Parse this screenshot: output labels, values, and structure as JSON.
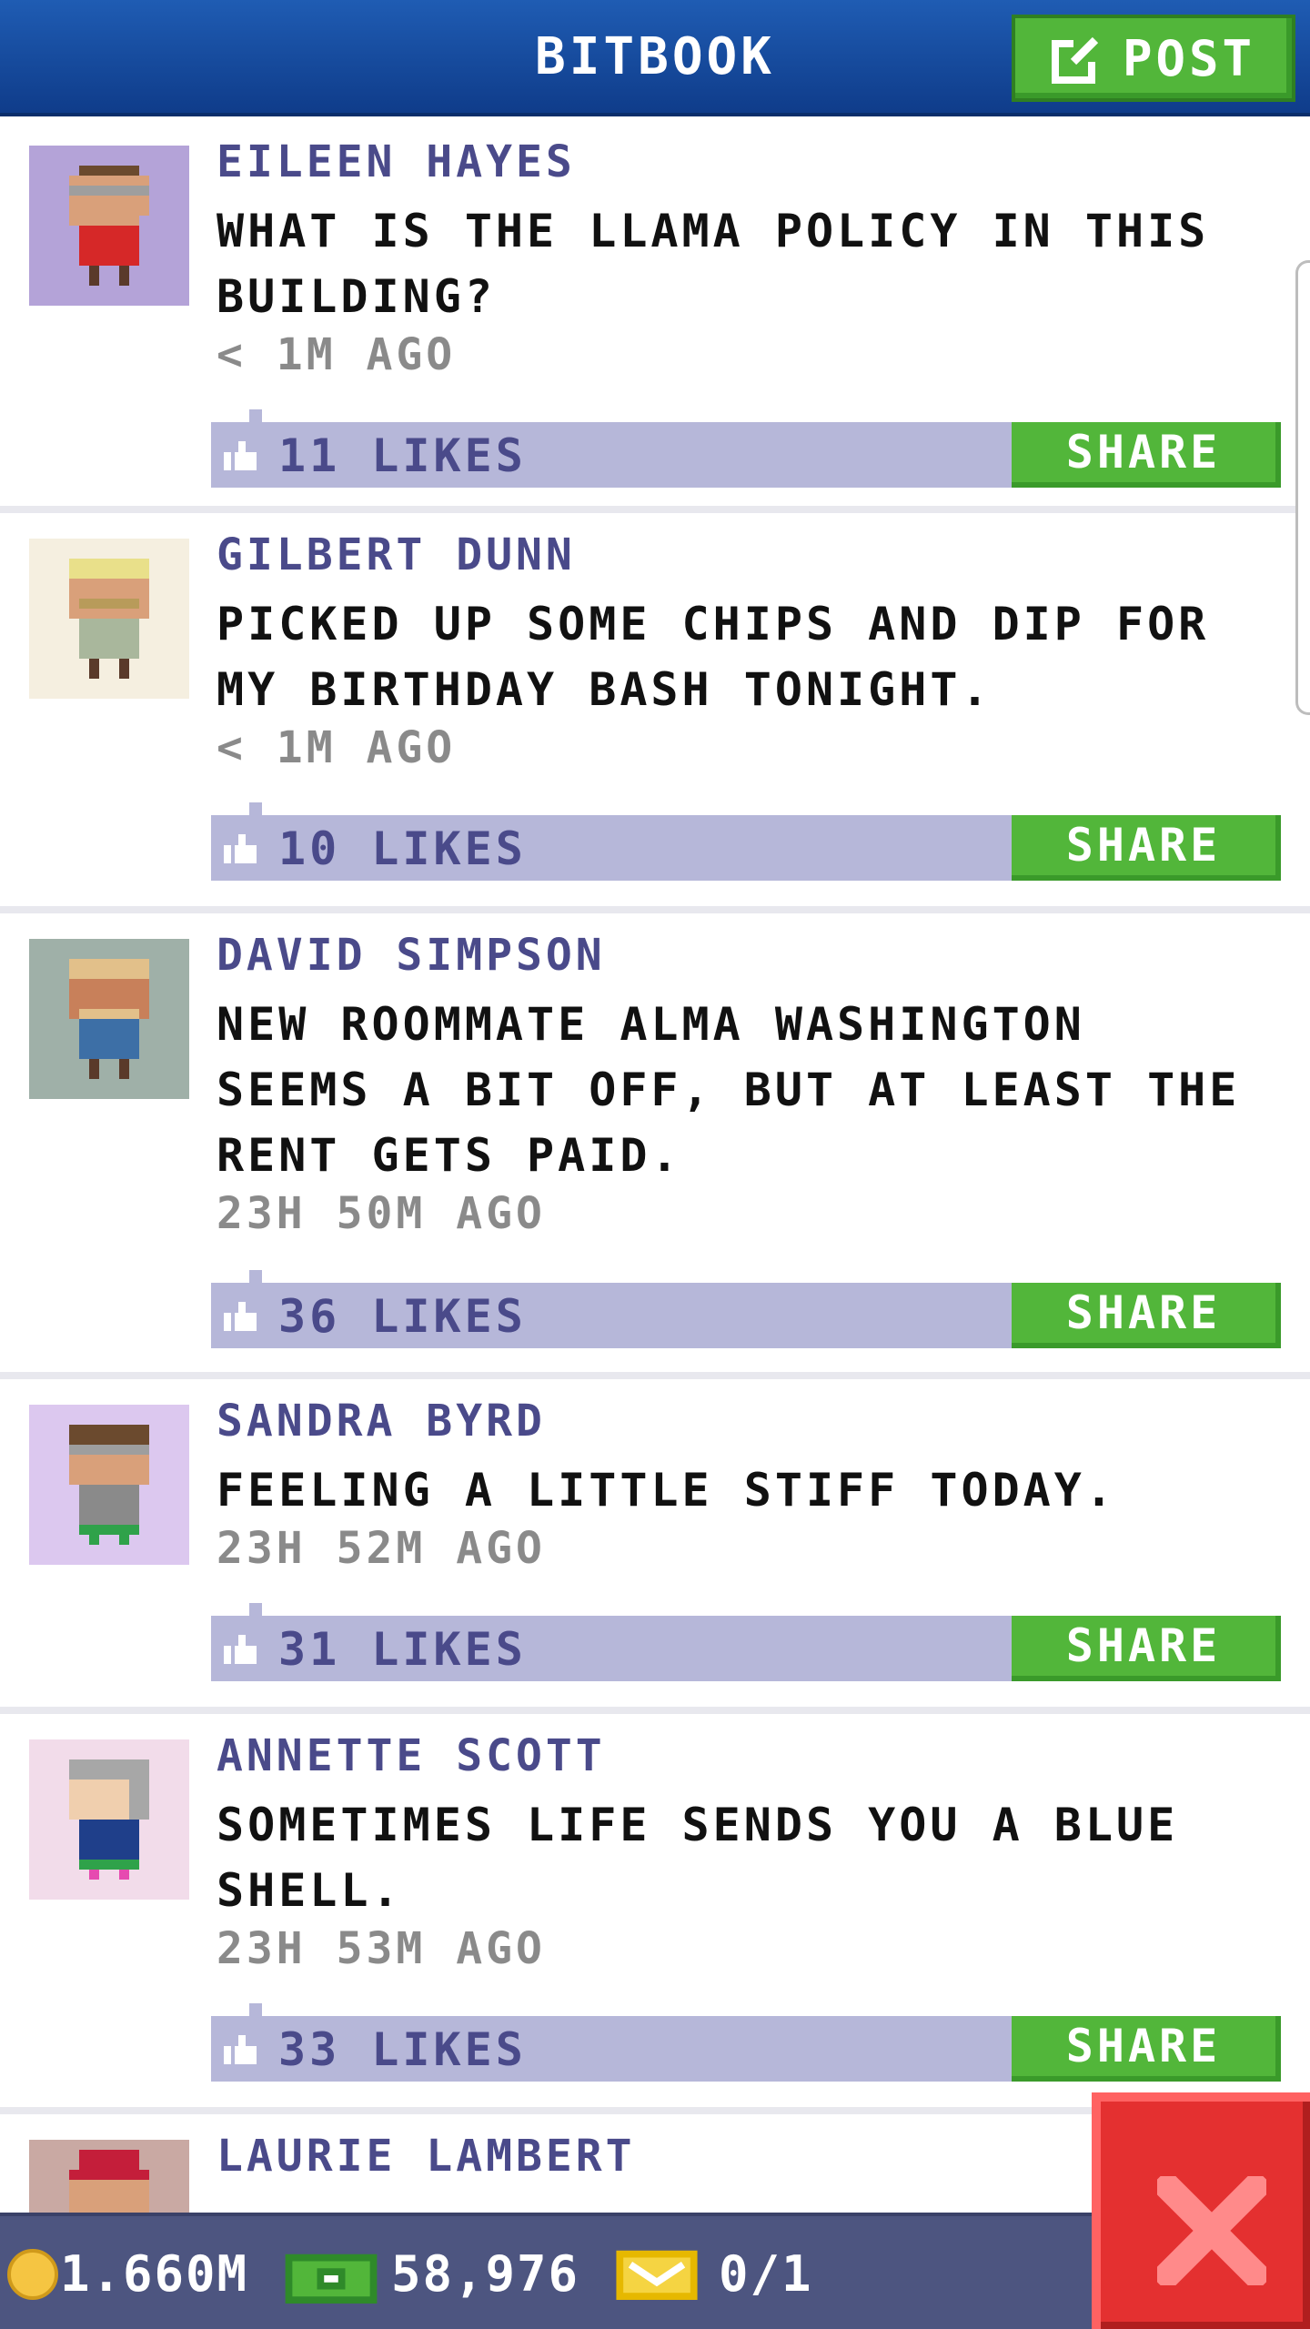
{
  "header": {
    "title": "BITBOOK",
    "post_label": "POST"
  },
  "posts": [
    {
      "author": "EILEEN HAYES",
      "text": "WHAT IS THE LLAMA POLICY IN THIS BUILDING?",
      "time": "< 1M AGO",
      "likes": "11 LIKES",
      "share_label": "SHARE",
      "avatar_bg": "#b4a3d8"
    },
    {
      "author": "GILBERT DUNN",
      "text": "PICKED UP SOME CHIPS AND DIP FOR MY BIRTHDAY BASH TONIGHT.",
      "time": "< 1M AGO",
      "likes": "10 LIKES",
      "share_label": "SHARE",
      "avatar_bg": "#f5efe0"
    },
    {
      "author": "DAVID SIMPSON",
      "text": "NEW ROOMMATE ALMA WASHINGTON SEEMS A BIT OFF, BUT AT LEAST THE RENT GETS PAID.",
      "time": "23H 50M AGO",
      "likes": "36 LIKES",
      "share_label": "SHARE",
      "avatar_bg": "#9fb0a8"
    },
    {
      "author": "SANDRA BYRD",
      "text": "FEELING A LITTLE STIFF TODAY.",
      "time": "23H 52M AGO",
      "likes": "31 LIKES",
      "share_label": "SHARE",
      "avatar_bg": "#dcc8ef"
    },
    {
      "author": "ANNETTE SCOTT",
      "text": "SOMETIMES LIFE SENDS YOU A BLUE SHELL.",
      "time": "23H 53M AGO",
      "likes": "33 LIKES",
      "share_label": "SHARE",
      "avatar_bg": "#f2dcea"
    },
    {
      "author": "LAURIE LAMBERT",
      "avatar_bg": "#c9a9a3"
    }
  ],
  "status": {
    "coins": "1.660M",
    "bux": "58,976",
    "tickets": "0/1"
  },
  "colors": {
    "header": "#1f5cb3",
    "share": "#52b63a",
    "likes_bar": "#b6b7d9",
    "status_bar": "#4d5580",
    "close": "#e43030"
  }
}
